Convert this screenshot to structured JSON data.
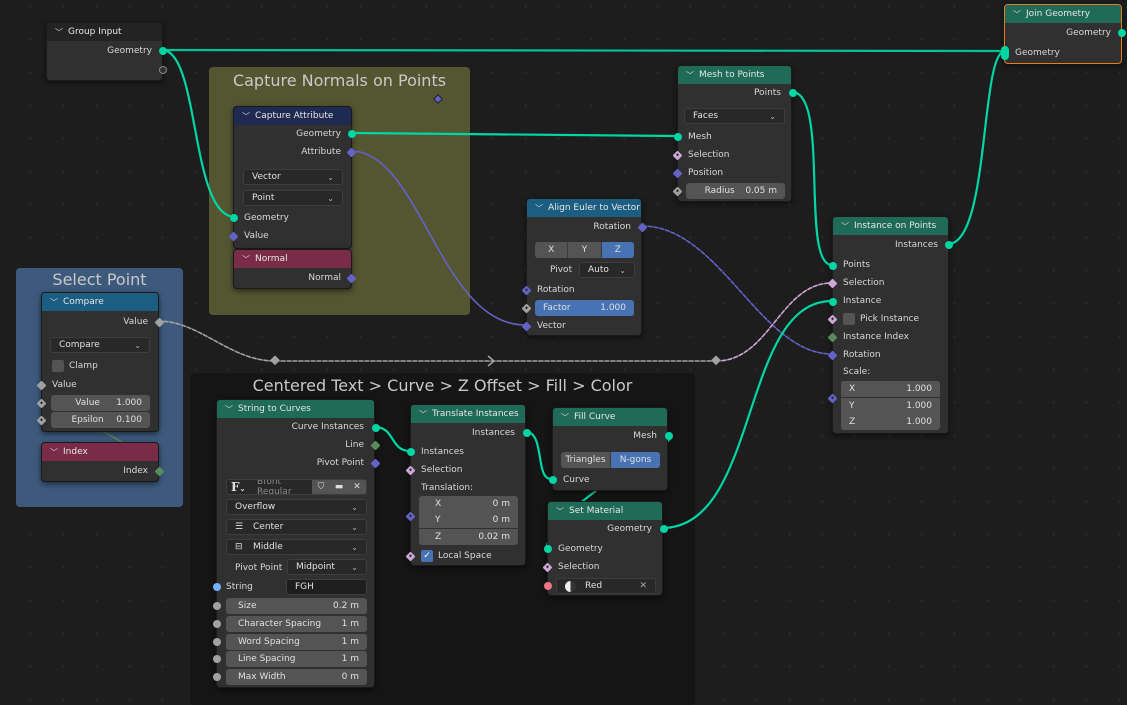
{
  "frames": {
    "capture_normals": {
      "label": "Capture Normals on Points",
      "color": "#545632"
    },
    "select_point": {
      "label": "Select Point",
      "color": "#3d5a7d"
    },
    "text_chain": {
      "label": "Centered Text > Curve >  Z Offset > Fill > Color",
      "color": "#151515"
    }
  },
  "nodes": {
    "group_input": {
      "title": "Group Input",
      "outputs": [
        "Geometry"
      ]
    },
    "capture_attribute": {
      "title": "Capture Attribute",
      "outputs": [
        "Geometry",
        "Attribute"
      ],
      "data_type": "Vector",
      "domain": "Point",
      "inputs": [
        "Geometry",
        "Value"
      ]
    },
    "normal": {
      "title": "Normal",
      "outputs": [
        "Normal"
      ]
    },
    "compare": {
      "title": "Compare",
      "outputs": [
        "Value"
      ],
      "mode": "Compare",
      "clamp_label": "Clamp",
      "clamp_checked": false,
      "inputs": {
        "value_label": "Value",
        "value2_label": "Value",
        "value2": "1.000",
        "epsilon_label": "Epsilon",
        "epsilon": "0.100"
      }
    },
    "index": {
      "title": "Index",
      "outputs": [
        "Index"
      ]
    },
    "mesh_to_points": {
      "title": "Mesh to Points",
      "outputs": [
        "Points"
      ],
      "mode": "Faces",
      "inputs": [
        "Mesh",
        "Selection",
        "Position"
      ],
      "radius_label": "Radius",
      "radius": "0.05 m"
    },
    "align_euler": {
      "title": "Align Euler to Vector",
      "outputs": [
        "Rotation"
      ],
      "axes": [
        "X",
        "Y",
        "Z"
      ],
      "active_axis": "Z",
      "pivot_label": "Pivot",
      "pivot": "Auto",
      "inputs": [
        "Rotation",
        "Vector"
      ],
      "factor_label": "Factor",
      "factor": "1.000"
    },
    "instance_on_points": {
      "title": "Instance on Points",
      "outputs": [
        "Instances"
      ],
      "inputs": [
        "Points",
        "Selection",
        "Instance",
        "Pick Instance",
        "Instance Index",
        "Rotation"
      ],
      "pick_instance_checked": false,
      "scale_label": "Scale:",
      "scale": [
        {
          "axis": "X",
          "value": "1.000"
        },
        {
          "axis": "Y",
          "value": "1.000"
        },
        {
          "axis": "Z",
          "value": "1.000"
        }
      ]
    },
    "join_geometry": {
      "title": "Join Geometry",
      "outputs": [
        "Geometry"
      ],
      "inputs": [
        "Geometry"
      ]
    },
    "string_to_curves": {
      "title": "String to Curves",
      "outputs": [
        "Curve Instances",
        "Line",
        "Pivot Point"
      ],
      "font": "Bfont Regular",
      "overflow": "Overflow",
      "align_x": "Center",
      "align_y": "Middle",
      "pivot_label": "Pivot Point",
      "pivot": "Midpoint",
      "string_label": "String",
      "string": "FGH",
      "fields": [
        {
          "label": "Size",
          "value": "0.2 m"
        },
        {
          "label": "Character Spacing",
          "value": "1 m"
        },
        {
          "label": "Word Spacing",
          "value": "1 m"
        },
        {
          "label": "Line Spacing",
          "value": "1 m"
        },
        {
          "label": "Max Width",
          "value": "0 m"
        }
      ]
    },
    "translate_instances": {
      "title": "Translate Instances",
      "outputs": [
        "Instances"
      ],
      "inputs": [
        "Instances",
        "Selection"
      ],
      "translation_label": "Translation:",
      "translation": [
        {
          "axis": "X",
          "value": "0 m"
        },
        {
          "axis": "Y",
          "value": "0 m"
        },
        {
          "axis": "Z",
          "value": "0.02 m"
        }
      ],
      "local_space_label": "Local Space",
      "local_space_checked": true
    },
    "fill_curve": {
      "title": "Fill Curve",
      "outputs": [
        "Mesh"
      ],
      "modes": [
        "Triangles",
        "N-gons"
      ],
      "active_mode": "N-gons",
      "inputs": [
        "Curve"
      ]
    },
    "set_material": {
      "title": "Set Material",
      "outputs": [
        "Geometry"
      ],
      "inputs": [
        "Geometry",
        "Selection"
      ],
      "material": "Red"
    }
  },
  "colors": {
    "geometry_link": "#00d6a3",
    "vector_link": "#6363c7",
    "float_link": "#a1a1a1",
    "bool_link": "#cca6d6",
    "active_node_border": "#e87d1e",
    "selected_field": "#4772b3"
  }
}
